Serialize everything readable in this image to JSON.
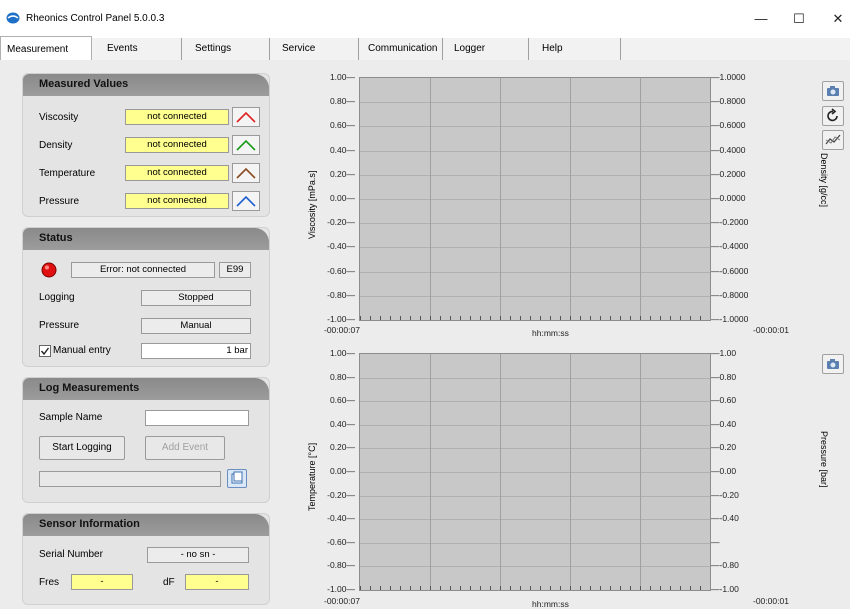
{
  "window": {
    "title": "Rheonics Control Panel 5.0.0.3",
    "minimize": "—",
    "maximize": "☐",
    "close": "✕"
  },
  "tabs": [
    "Measurement",
    "Events",
    "Settings",
    "Service",
    "Communication",
    "Logger",
    "Help"
  ],
  "measured_values": {
    "title": "Measured Values",
    "rows": [
      {
        "label": "Viscosity",
        "value": "not connected",
        "color": "#e02020"
      },
      {
        "label": "Density",
        "value": "not connected",
        "color": "#1a9a1a"
      },
      {
        "label": "Temperature",
        "value": "not connected",
        "color": "#8a4a20"
      },
      {
        "label": "Pressure",
        "value": "not connected",
        "color": "#1f5fd0"
      }
    ]
  },
  "status": {
    "title": "Status",
    "error_text": "Error: not connected",
    "error_code": "E99",
    "led_color": "#e01010",
    "logging_label": "Logging",
    "logging_value": "Stopped",
    "pressure_label": "Pressure",
    "pressure_value": "Manual",
    "manual_entry_label": "Manual entry",
    "manual_entry_checked": true,
    "manual_value": "1 bar"
  },
  "log_measurements": {
    "title": "Log Measurements",
    "sample_name_label": "Sample Name",
    "sample_name_value": "",
    "start_logging": "Start Logging",
    "add_event": "Add Event",
    "path_value": ""
  },
  "sensor_information": {
    "title": "Sensor Information",
    "serial_label": "Serial Number",
    "serial_value": "- no sn -",
    "fres_label": "Fres",
    "fres_value": "-",
    "df_label": "dF",
    "df_value": "-"
  },
  "chart_data": [
    {
      "type": "line",
      "ylabel": "Viscosity [mPa.s]",
      "y2label": "Density [g/cc]",
      "xlabel": "hh:mm:ss",
      "x_start": "-00:00:07",
      "x_end": "-00:00:01",
      "yticks": [
        "1.00",
        "0.80",
        "0.60",
        "0.40",
        "0.20",
        "0.00",
        "-0.20",
        "-0.40",
        "-0.60",
        "-0.80",
        "-1.00"
      ],
      "y2ticks": [
        "1.0000",
        "0.8000",
        "0.6000",
        "0.4000",
        "0.2000",
        "0.0000",
        "-0.2000",
        "-0.4000",
        "-0.6000",
        "-0.8000",
        "-1.0000"
      ],
      "ylim": [
        -1,
        1
      ],
      "series": []
    },
    {
      "type": "line",
      "ylabel": "Temperature [°C]",
      "y2label": "Pressure [bar]",
      "xlabel": "hh:mm:ss",
      "x_start": "-00:00:07",
      "x_end": "-00:00:01",
      "yticks": [
        "1.00",
        "0.80",
        "0.60",
        "0.40",
        "0.20",
        "0.00",
        "-0.20",
        "-0.40",
        "-0.60",
        "-0.80",
        "-1.00"
      ],
      "y2ticks": [
        "1.00",
        "0.80",
        "0.60",
        "0.40",
        "0.20",
        "0.00",
        "-0.20",
        "-0.40",
        "",
        "-0.80",
        "-1.00"
      ],
      "ylim": [
        -1,
        1
      ],
      "series": []
    }
  ]
}
